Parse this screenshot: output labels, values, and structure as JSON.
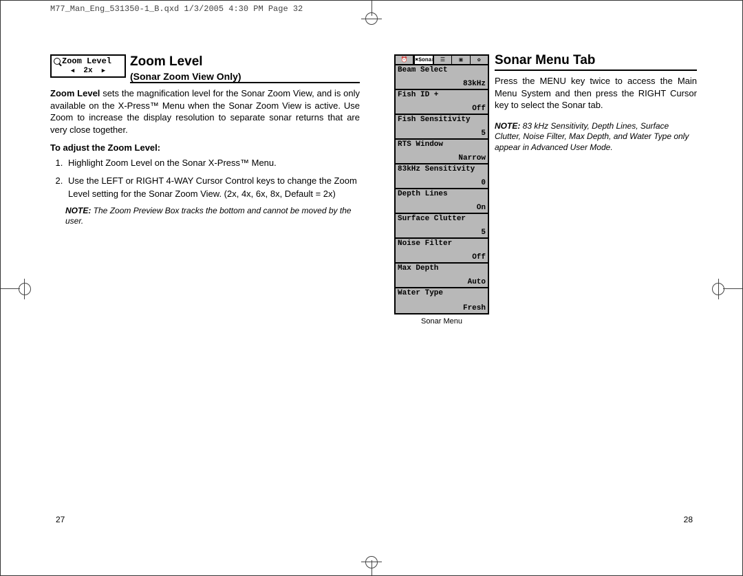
{
  "print_header": "M77_Man_Eng_531350-1_B.qxd  1/3/2005  4:30 PM  Page 32",
  "left": {
    "badge_top": "Zoom Level",
    "badge_value": "2x",
    "title": "Zoom Level",
    "subtitle": "(Sonar Zoom View Only)",
    "body_lead": "Zoom Level",
    "body_rest": " sets the magnification level for the Sonar Zoom View, and is only available on the X-Press™ Menu when the Sonar Zoom View is active. Use Zoom to increase the display resolution to separate sonar returns that are very close together.",
    "adjust_head": "To adjust the Zoom Level:",
    "step1": "Highlight Zoom Level on the Sonar X-Press™ Menu.",
    "step2": "Use the LEFT or RIGHT 4-WAY Cursor Control keys to change the Zoom Level setting for the Sonar Zoom View. (2x, 4x, 6x, 8x, Default = 2x)",
    "note_label": "NOTE:",
    "note_text": " The Zoom Preview Box tracks the bottom and cannot be moved by the user.",
    "page_no": "27"
  },
  "right": {
    "title": "Sonar Menu Tab",
    "body": "Press the MENU key twice to access the Main Menu System and then press the RIGHT Cursor key to select the Sonar tab.",
    "note_label": "NOTE:",
    "note_text": " 83 kHz Sensitivity, Depth Lines, Surface Clutter, Noise Filter, Max Depth, and Water Type only appear in Advanced User Mode.",
    "menu_caption": "Sonar Menu",
    "page_no": "28",
    "tab_active": "Sonar",
    "rows": [
      {
        "label": "Beam Select",
        "value": "83kHz"
      },
      {
        "label": "Fish ID +",
        "value": "Off"
      },
      {
        "label": "Fish Sensitivity",
        "value": "5"
      },
      {
        "label": "RTS Window",
        "value": "Narrow"
      },
      {
        "label": "83kHz Sensitivity",
        "value": "0"
      },
      {
        "label": "Depth Lines",
        "value": "On"
      },
      {
        "label": "Surface Clutter",
        "value": "5"
      },
      {
        "label": "Noise Filter",
        "value": "Off"
      },
      {
        "label": "Max Depth",
        "value": "Auto"
      },
      {
        "label": "Water Type",
        "value": "Fresh"
      }
    ]
  }
}
